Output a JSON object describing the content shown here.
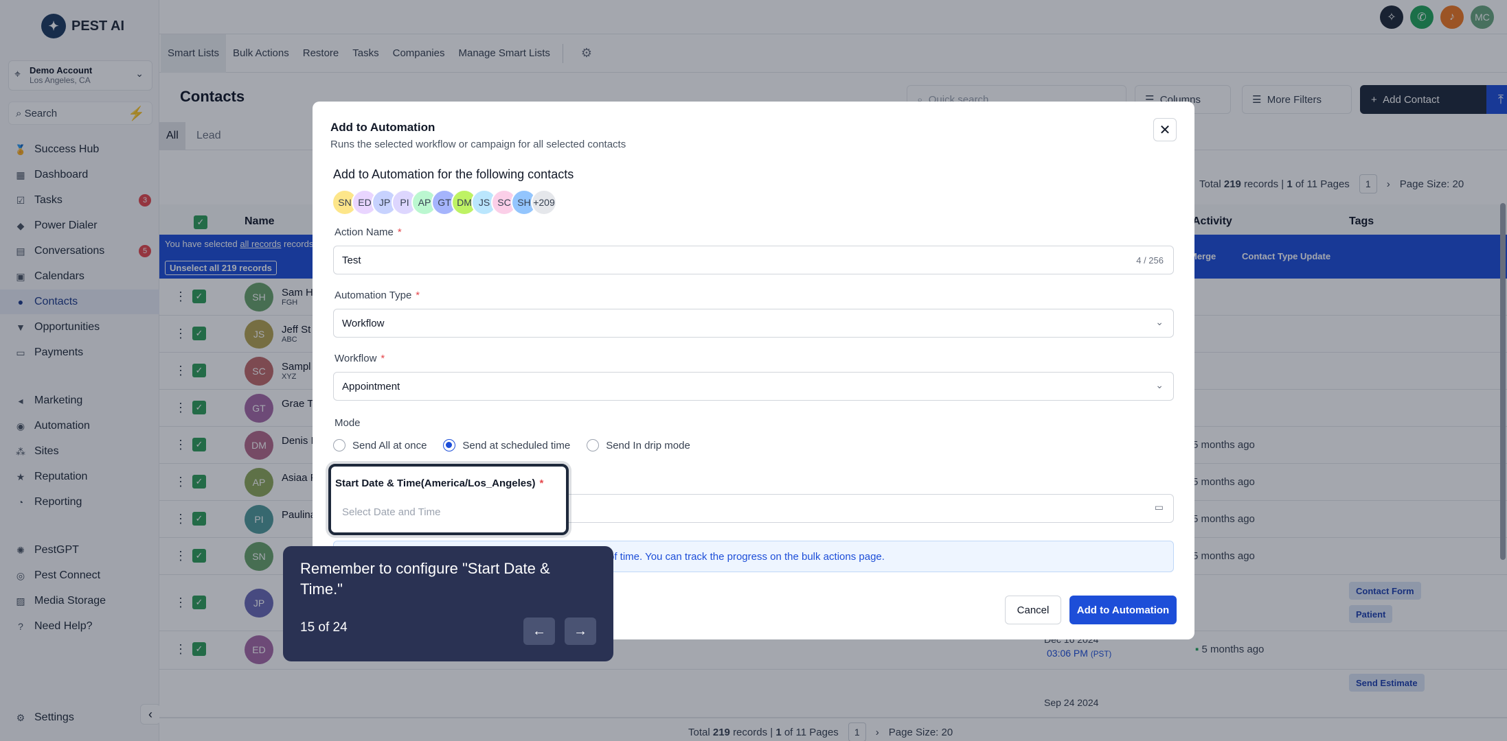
{
  "brand": {
    "name": "PEST AI"
  },
  "account": {
    "name": "Demo Account",
    "location": "Los Angeles, CA"
  },
  "sidebar": {
    "search_label": "Search",
    "items": [
      {
        "label": "Success Hub",
        "icon": "medal-icon"
      },
      {
        "label": "Dashboard",
        "icon": "dashboard-icon"
      },
      {
        "label": "Tasks",
        "icon": "checkbox-icon",
        "badge": "3"
      },
      {
        "label": "Power Dialer",
        "icon": "gem-icon"
      },
      {
        "label": "Conversations",
        "icon": "chat-icon",
        "badge": "5"
      },
      {
        "label": "Calendars",
        "icon": "calendar-icon"
      },
      {
        "label": "Contacts",
        "icon": "person-icon",
        "active": true
      },
      {
        "label": "Opportunities",
        "icon": "funnel-icon"
      },
      {
        "label": "Payments",
        "icon": "card-icon"
      },
      {
        "label": "Marketing",
        "icon": "megaphone-icon"
      },
      {
        "label": "Automation",
        "icon": "automation-icon"
      },
      {
        "label": "Sites",
        "icon": "sitemap-icon"
      },
      {
        "label": "Reputation",
        "icon": "star-icon"
      },
      {
        "label": "Reporting",
        "icon": "pie-icon"
      },
      {
        "label": "PestGPT",
        "icon": "robot-icon"
      },
      {
        "label": "Pest Connect",
        "icon": "connect-icon"
      },
      {
        "label": "Media Storage",
        "icon": "image-icon"
      },
      {
        "label": "Need Help?",
        "icon": "help-icon"
      }
    ],
    "settings_label": "Settings"
  },
  "topbar": {
    "avatar_initials": "MC"
  },
  "tabs": [
    "Smart Lists",
    "Bulk Actions",
    "Restore",
    "Tasks",
    "Companies",
    "Manage Smart Lists"
  ],
  "page": {
    "title": "Contacts",
    "quick_search_placeholder": "Quick search",
    "columns_label": "Columns",
    "more_filters_label": "More Filters",
    "add_contact_label": "Add Contact"
  },
  "filter_tabs": [
    "All",
    "Lead"
  ],
  "pager_top": {
    "total_prefix": "Total",
    "total": "219",
    "records_text": "records |",
    "page": "1",
    "of_pages": "of 11 Pages",
    "current": "1",
    "page_size": "Page Size: 20"
  },
  "table": {
    "headers": {
      "name": "Name",
      "activity": "Activity",
      "tags": "Tags"
    },
    "selection": {
      "text_prefix": "You have selected",
      "link": "all records",
      "text_suffix": "records.",
      "unselect": "Unselect all 219 records",
      "merge": "Merge",
      "contact_type_update": "Contact Type Update"
    },
    "rows": [
      {
        "initials": "SH",
        "color": "#6aa36b",
        "name": "Sam H",
        "sub": "FGH"
      },
      {
        "initials": "JS",
        "color": "#b5a452",
        "name": "Jeff St",
        "sub": "ABC"
      },
      {
        "initials": "SC",
        "color": "#c06a6a",
        "name": "Sampl",
        "sub": "XYZ"
      },
      {
        "initials": "GT",
        "color": "#a66aa6",
        "name": "Grae T",
        "sub": ""
      },
      {
        "initials": "DM",
        "color": "#b56a8a",
        "name": "Denis I",
        "sub": "",
        "activity": "5 months ago"
      },
      {
        "initials": "AP",
        "color": "#8ea85a",
        "name": "Asiaa F",
        "sub": "",
        "activity": "5 months ago"
      },
      {
        "initials": "PI",
        "color": "#4f9a9a",
        "name": "Paulina",
        "sub": "",
        "activity": "5 months ago"
      },
      {
        "initials": "SN",
        "color": "#6aa36b",
        "name": "",
        "sub": "",
        "activity": "5 months ago"
      },
      {
        "initials": "JP",
        "color": "#6a6ab5",
        "name": "",
        "sub": ""
      },
      {
        "initials": "ED",
        "color": "#a66aa6",
        "name": "",
        "sub": "",
        "date": "Dec 16 2024",
        "time": "03:06 PM",
        "tz": "(PST)",
        "activity": "5 months ago"
      }
    ],
    "partial_row_date": "Sep 24 2024",
    "tags": [
      "Contact Form",
      "Patient",
      "Send Estimate"
    ]
  },
  "pager_bottom": {
    "total_prefix": "Total",
    "total": "219",
    "records_text": "records |",
    "page": "1",
    "of_pages": "of 11 Pages",
    "current": "1",
    "page_size": "Page Size: 20"
  },
  "modal": {
    "title": "Add to Automation",
    "subtitle": "Runs the selected workflow or campaign for all selected contacts",
    "section": "Add to Automation for the following contacts",
    "avatars": [
      "SN",
      "ED",
      "JP",
      "PI",
      "AP",
      "GT",
      "DM",
      "JS",
      "SC",
      "SH"
    ],
    "more_count": "+209",
    "action_name_label": "Action Name",
    "action_name_value": "Test",
    "action_name_count": "4 / 256",
    "automation_type_label": "Automation Type",
    "automation_type_value": "Workflow",
    "workflow_label": "Workflow",
    "workflow_value": "Appointment",
    "mode_label": "Mode",
    "modes": [
      "Send All at once",
      "Send at scheduled time",
      "Send In drip mode"
    ],
    "selected_mode": "Send at scheduled time",
    "start_label": "Start Date & Time(America/Los_Angeles)",
    "start_placeholder": "Select Date and Time",
    "info_text": "of time. You can track the progress on the bulk actions page.",
    "cancel_label": "Cancel",
    "submit_label": "Add to Automation"
  },
  "tooltip": {
    "text": "Remember to configure \"Start Date & Time.\"",
    "step": "15 of 24"
  }
}
